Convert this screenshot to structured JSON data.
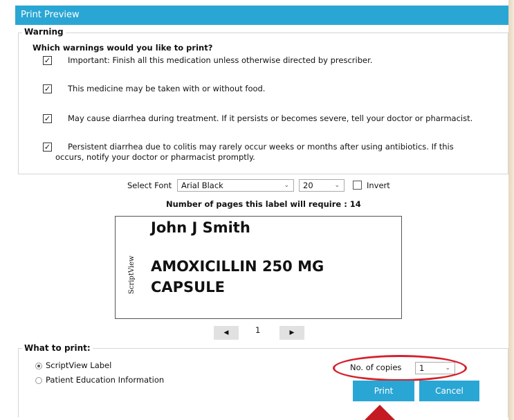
{
  "window": {
    "title": "Print Preview"
  },
  "warning_panel": {
    "legend": "Warning",
    "question": "Which warnings would you like to print?",
    "items": [
      {
        "checked": true,
        "text": "Important: Finish all this medication unless otherwise directed by prescriber."
      },
      {
        "checked": true,
        "text": "This medicine may be taken with or without food."
      },
      {
        "checked": true,
        "text": "May cause diarrhea during treatment. If it persists or becomes severe, tell your doctor or pharmacist."
      },
      {
        "checked": true,
        "text": "Persistent diarrhea due to colitis may rarely occur weeks or months after using antibiotics. If this",
        "text2": "occurs, notify your doctor or pharmacist promptly."
      }
    ],
    "check_glyph": "✓"
  },
  "font_controls": {
    "label": "Select Font",
    "font_value": "Arial Black",
    "size_value": "20",
    "invert_label": "Invert",
    "invert_checked": false,
    "arrow_glyph": "⌄"
  },
  "pages_text": "Number of pages this label will require : 14",
  "preview": {
    "side_text": "ScriptView",
    "patient_name": "John J Smith",
    "drug_line1": "AMOXICILLIN 250 MG",
    "drug_line2": "CAPSULE"
  },
  "pager": {
    "prev_glyph": "◀",
    "next_glyph": "▶",
    "page": "1"
  },
  "what_to_print": {
    "legend": "What to print:",
    "options": [
      {
        "label": "ScriptView Label",
        "selected": true
      },
      {
        "label": "Patient Education Information",
        "selected": false
      }
    ],
    "copies_label": "No. of copies",
    "copies_value": "1"
  },
  "buttons": {
    "print": "Print",
    "cancel": "Cancel"
  },
  "colors": {
    "accent": "#2aa6d4",
    "highlight_red": "#d6202a"
  }
}
